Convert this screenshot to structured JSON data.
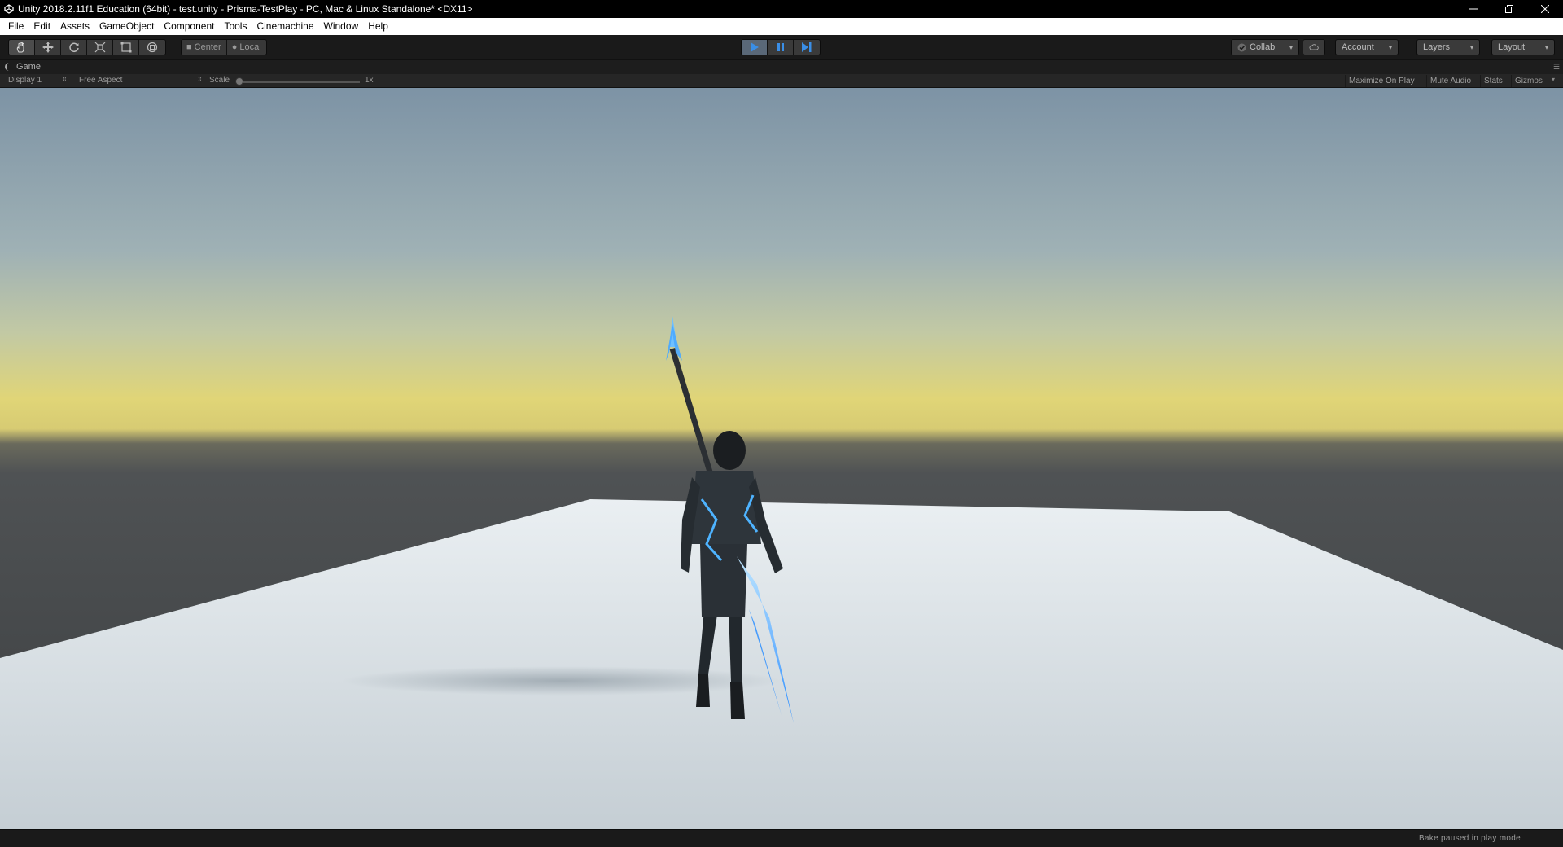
{
  "window": {
    "title": "Unity 2018.2.11f1 Education (64bit) - test.unity - Prisma-TestPlay - PC, Mac & Linux Standalone* <DX11>",
    "controls": [
      "minimize-icon",
      "restore-icon",
      "close-icon"
    ]
  },
  "menubar": {
    "items": [
      "File",
      "Edit",
      "Assets",
      "GameObject",
      "Component",
      "Tools",
      "Cinemachine",
      "Window",
      "Help"
    ]
  },
  "toolbar": {
    "transform_tools": [
      "hand-tool-icon",
      "move-tool-icon",
      "rotate-tool-icon",
      "scale-tool-icon",
      "rect-tool-icon",
      "transform-tool-icon"
    ],
    "pivot_mode": "Center",
    "pivot_rotation": "Local",
    "play_controls": [
      "play-icon",
      "pause-icon",
      "step-icon"
    ],
    "collab_label": "Collab",
    "account_label": "Account",
    "layers_label": "Layers",
    "layout_label": "Layout"
  },
  "game_view": {
    "tab_label": "Game",
    "display": "Display 1",
    "aspect": "Free Aspect",
    "scale_label": "Scale",
    "scale_value": "1x",
    "maximize_label": "Maximize On Play",
    "mute_label": "Mute Audio",
    "stats_label": "Stats",
    "gizmos_label": "Gizmos"
  },
  "statusbar": {
    "message": "Bake paused in play mode"
  },
  "colors": {
    "play_active": "#5a6878",
    "accent_blue": "#3a8ee6",
    "sky_top": "#7d93a5",
    "horizon_yellow": "#e0d577",
    "ground": "#e2e8ec"
  }
}
